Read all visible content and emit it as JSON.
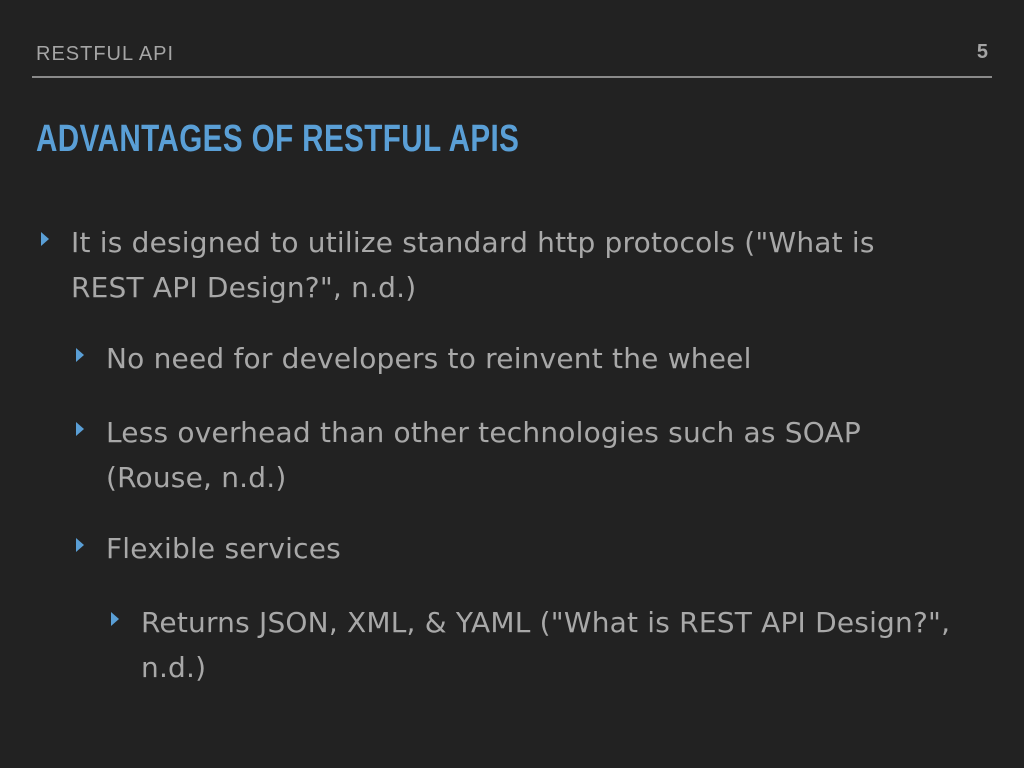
{
  "header": {
    "section_label": "RESTFUL API",
    "page_number": "5"
  },
  "slide": {
    "title": "ADVANTAGES OF RESTFUL APIS",
    "bullets": [
      {
        "level": 1,
        "text": "It is designed to utilize standard http protocols (\"What is REST API Design?\", n.d.)"
      },
      {
        "level": 2,
        "text": "No need for developers to reinvent the wheel"
      },
      {
        "level": 2,
        "text": "Less overhead than other technologies such as SOAP (Rouse, n.d.)"
      },
      {
        "level": 2,
        "text": "Flexible services"
      },
      {
        "level": 3,
        "text": "Returns JSON, XML, & YAML (\"What is REST API Design?\", n.d.)"
      }
    ]
  },
  "colors": {
    "background": "#222222",
    "accent": "#5a9fd6",
    "body_text": "#a8a8a8"
  },
  "icons": {
    "bullet": "triangle-right-icon"
  }
}
